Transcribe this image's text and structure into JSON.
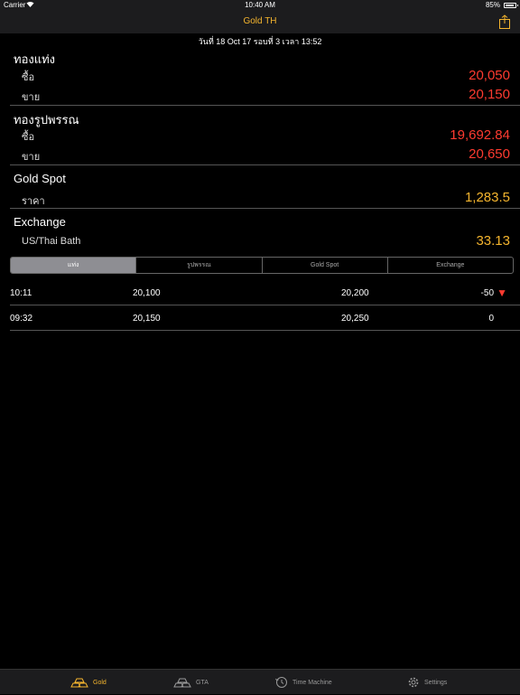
{
  "status_bar": {
    "carrier": "Carrier",
    "time": "10:40 AM",
    "battery": "85%",
    "battery_level": 0.85
  },
  "nav": {
    "title": "Gold TH"
  },
  "updated_text": "วันที่ 18 Oct 17 รอบที่ 3 เวลา 13:52",
  "sections": {
    "bar": {
      "title": "ทองแท่ง",
      "buy_label": "ซื้อ",
      "buy_value": "20,050",
      "sell_label": "ขาย",
      "sell_value": "20,150"
    },
    "ornament": {
      "title": "ทองรูปพรรณ",
      "buy_label": "ซื้อ",
      "buy_value": "19,692.84",
      "sell_label": "ขาย",
      "sell_value": "20,650"
    },
    "spot": {
      "title": "Gold Spot",
      "price_label": "ราคา",
      "price_value": "1,283.5"
    },
    "exchange": {
      "title": "Exchange",
      "rate_label": "US/Thai Bath",
      "rate_value": "33.13"
    }
  },
  "segments": [
    "แท่ง",
    "รูปพรรณ",
    "Gold Spot",
    "Exchange"
  ],
  "history": [
    {
      "time": "10:11",
      "buy": "20,100",
      "sell": "20,200",
      "change": "-50",
      "trend": "down"
    },
    {
      "time": "09:32",
      "buy": "20,150",
      "sell": "20,250",
      "change": "0",
      "trend": "none"
    }
  ],
  "tabs": [
    {
      "label": "Gold",
      "icon": "gold-bars-icon",
      "active": true
    },
    {
      "label": "GTA",
      "icon": "gold-bars-outline-icon",
      "active": false
    },
    {
      "label": "Time Machine",
      "icon": "clock-history-icon",
      "active": false
    },
    {
      "label": "Settings",
      "icon": "gear-icon",
      "active": false
    }
  ],
  "colors": {
    "accent": "#f5b52e",
    "negative": "#ff3b30",
    "background": "#000000"
  }
}
